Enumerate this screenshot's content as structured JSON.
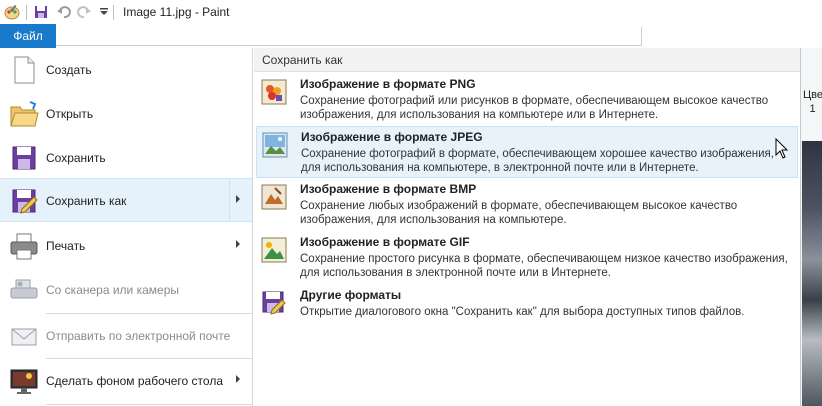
{
  "window": {
    "title": "Image 11.jpg - Paint"
  },
  "ribbon": {
    "file_tab": "Файл"
  },
  "background": {
    "colors_label": "Цве",
    "colors_num": "1"
  },
  "menu": {
    "items": [
      {
        "label": "Создать",
        "icon": "new-document-icon",
        "enabled": true,
        "submenu": false
      },
      {
        "label": "Открыть",
        "icon": "open-folder-icon",
        "enabled": true,
        "submenu": false
      },
      {
        "label": "Сохранить",
        "icon": "save-disk-icon",
        "enabled": true,
        "submenu": false
      },
      {
        "label": "Сохранить как",
        "icon": "save-as-icon",
        "enabled": true,
        "submenu": true,
        "selected": true
      },
      {
        "label": "Печать",
        "icon": "printer-icon",
        "enabled": true,
        "submenu": true
      },
      {
        "label": "Со сканера или камеры",
        "icon": "scanner-icon",
        "enabled": false,
        "submenu": false
      },
      {
        "label": "Отправить по электронной почте",
        "icon": "email-icon",
        "enabled": false,
        "submenu": false
      },
      {
        "label": "Сделать фоном рабочего стола",
        "icon": "desktop-background-icon",
        "enabled": true,
        "submenu": true
      }
    ]
  },
  "save_as": {
    "header": "Сохранить как",
    "formats": [
      {
        "title": "Изображение в формате PNG",
        "description": "Сохранение фотографий или рисунков в формате, обеспечивающем высокое качество изображения, для использования на компьютере или в Интернете.",
        "icon": "png-icon"
      },
      {
        "title": "Изображение в формате JPEG",
        "description": "Сохранение фотографий в формате, обеспечивающем хорошее качество изображения, для использования на компьютере, в электронной почте или в Интернете.",
        "icon": "jpeg-icon",
        "highlighted": true
      },
      {
        "title": "Изображение в формате BMP",
        "description": "Сохранение любых изображений в формате, обеспечивающем высокое качество изображения, для использования на компьютере.",
        "icon": "bmp-icon"
      },
      {
        "title": "Изображение в формате GIF",
        "description": "Сохранение простого рисунка в формате, обеспечивающем низкое качество изображения, для использования в электронной почте или в Интернете.",
        "icon": "gif-icon"
      },
      {
        "title": "Другие форматы",
        "description": "Открытие диалогового окна \"Сохранить как\" для выбора доступных типов файлов.",
        "icon": "other-formats-icon"
      }
    ]
  },
  "colors": {
    "accent": "#1979ca",
    "selected_bg": "#e5f1fb"
  }
}
